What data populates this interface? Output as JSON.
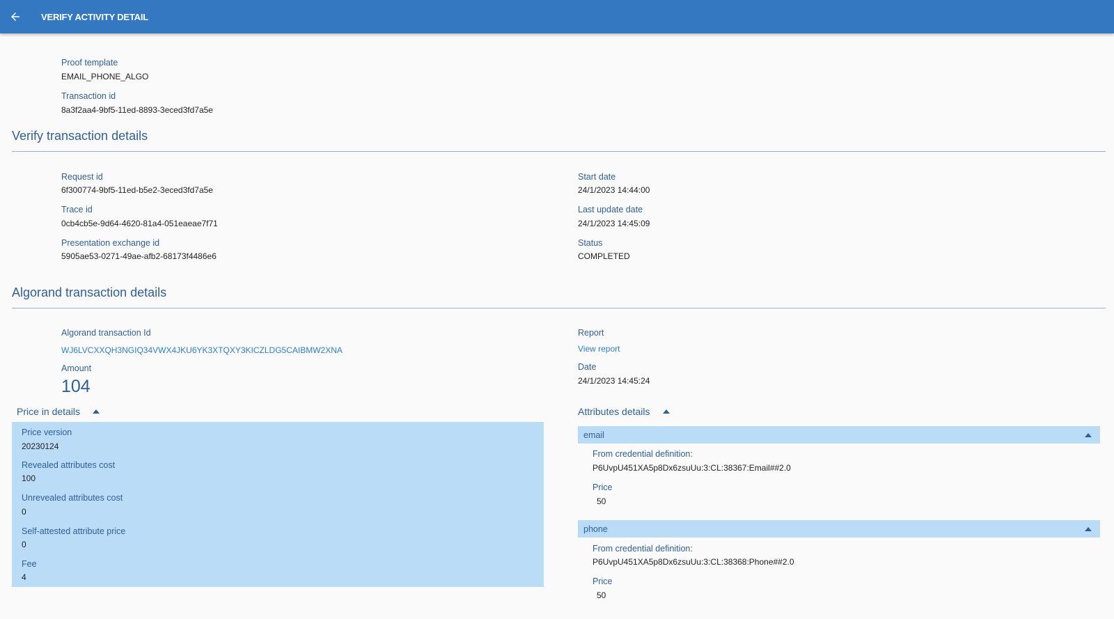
{
  "header": {
    "title": "VERIFY ACTIVITY DETAIL",
    "back_icon": "arrow-left-icon"
  },
  "summary": {
    "proof_template_label": "Proof template",
    "proof_template_value": "EMAIL_PHONE_ALGO",
    "transaction_id_label": "Transaction id",
    "transaction_id_value": "8a3f2aa4-9bf5-11ed-8893-3eced3fd7a5e"
  },
  "verify_section": {
    "title": "Verify transaction details",
    "request_id_label": "Request id",
    "request_id_value": "6f300774-9bf5-11ed-b5e2-3eced3fd7a5e",
    "trace_id_label": "Trace id",
    "trace_id_value": "0cb4cb5e-9d64-4620-81a4-051eaeae7f71",
    "presentation_label": "Presentation exchange id",
    "presentation_value": "5905ae53-0271-49ae-afb2-68173f4486e6",
    "start_date_label": "Start date",
    "start_date_value": "24/1/2023 14:44:00",
    "last_update_label": "Last update date",
    "last_update_value": "24/1/2023 14:45:09",
    "status_label": "Status",
    "status_value": "COMPLETED"
  },
  "algorand_section": {
    "title": "Algorand transaction details",
    "tx_id_label": "Algorand transaction Id",
    "tx_id_value": "WJ6LVCXXQH3NGIQ34VWX4JKU6YK3XTQXY3KICZLDG5CAIBMW2XNA",
    "amount_label": "Amount",
    "amount_value": "104",
    "report_label": "Report",
    "report_link": "View report",
    "date_label": "Date",
    "date_value": "24/1/2023 14:45:24"
  },
  "price_details": {
    "title": "Price in details",
    "price_version_label": "Price version",
    "price_version_value": "20230124",
    "revealed_label": "Revealed attributes cost",
    "revealed_value": "100",
    "unrevealed_label": "Unrevealed attributes cost",
    "unrevealed_value": "0",
    "self_attested_label": "Self-attested attribute price",
    "self_attested_value": "0",
    "fee_label": "Fee",
    "fee_value": "4"
  },
  "attributes": {
    "title": "Attributes details",
    "items": [
      {
        "name": "email",
        "cred_def_label": "From credential definition:",
        "cred_def_value": "P6UvpU451XA5p8Dx6zsuUu:3:CL:38367:Email##2.0",
        "price_label": "Price",
        "price_value": "50"
      },
      {
        "name": "phone",
        "cred_def_label": "From credential definition:",
        "cred_def_value": "P6UvpU451XA5p8Dx6zsuUu:3:CL:38368:Phone##2.0",
        "price_label": "Price",
        "price_value": "50"
      }
    ]
  },
  "colors": {
    "header": "#3378c1",
    "accent": "#2f5f97",
    "panel": "#badcf7",
    "link": "#2e7fd0"
  }
}
